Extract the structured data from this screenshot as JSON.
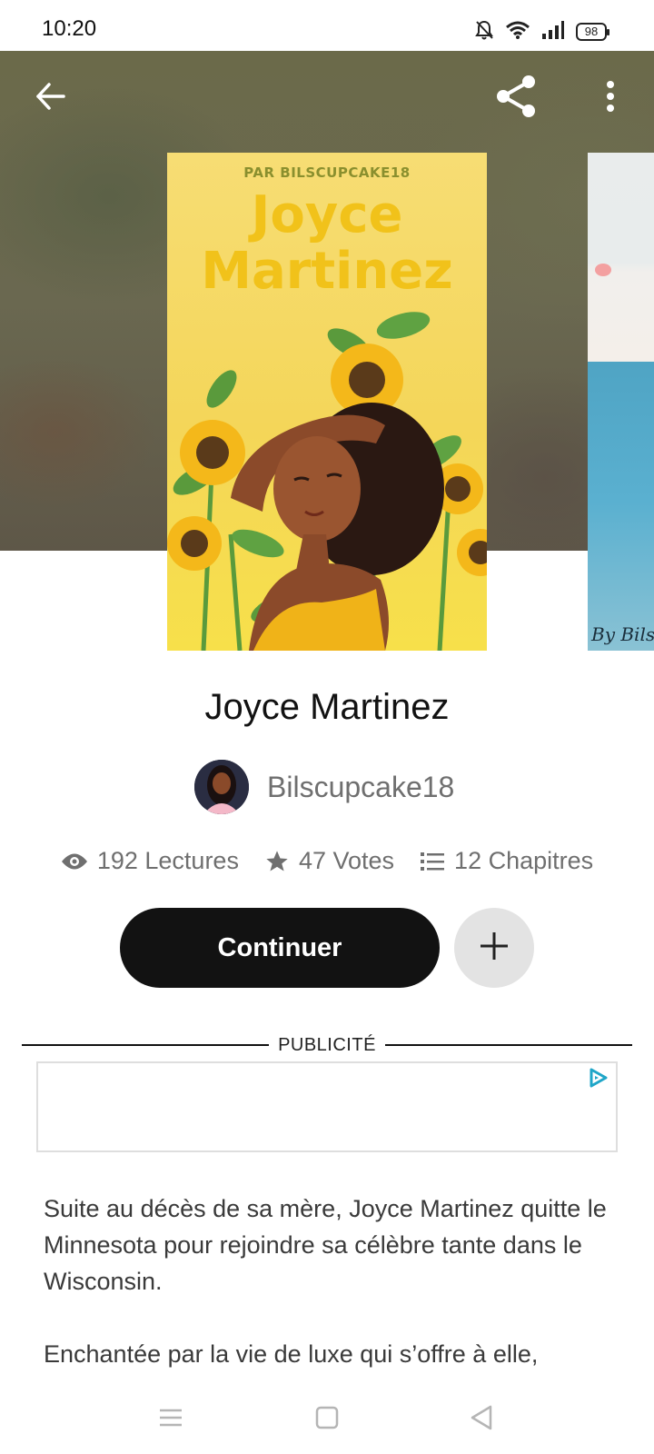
{
  "status_bar": {
    "time": "10:20",
    "battery": "98",
    "icons": [
      "bell-off-icon",
      "wifi-icon",
      "signal-icon",
      "battery-icon"
    ]
  },
  "header": {
    "icons": [
      "back-arrow-icon",
      "share-icon",
      "more-vertical-icon"
    ]
  },
  "cover": {
    "by_line": "PAR BILSCUPCAKE18",
    "title_line1": "Joyce",
    "title_line2": "Martinez",
    "next_cover_signature": "By Bils"
  },
  "story": {
    "title": "Joyce Martinez",
    "author": "Bilscupcake18",
    "stats": {
      "reads": "192 Lectures",
      "votes": "47 Votes",
      "chapters": "12 Chapitres"
    },
    "continue_label": "Continuer"
  },
  "ad": {
    "label": "PUBLICITÉ"
  },
  "description": {
    "paragraph1": "Suite au décès de sa mère, Joyce Martinez quitte le Minnesota pour rejoindre sa célèbre tante dans le Wisconsin.",
    "paragraph2": "Enchantée par la vie de luxe qui s’offre à elle,"
  },
  "colors": {
    "cover_yellow": "#f4d659",
    "cover_title": "#f1c21a",
    "button_dark": "#121212",
    "muted_text": "#6f6f6f"
  },
  "nav_bar": {
    "icons": [
      "menu-icon",
      "home-square-icon",
      "back-triangle-icon"
    ]
  }
}
